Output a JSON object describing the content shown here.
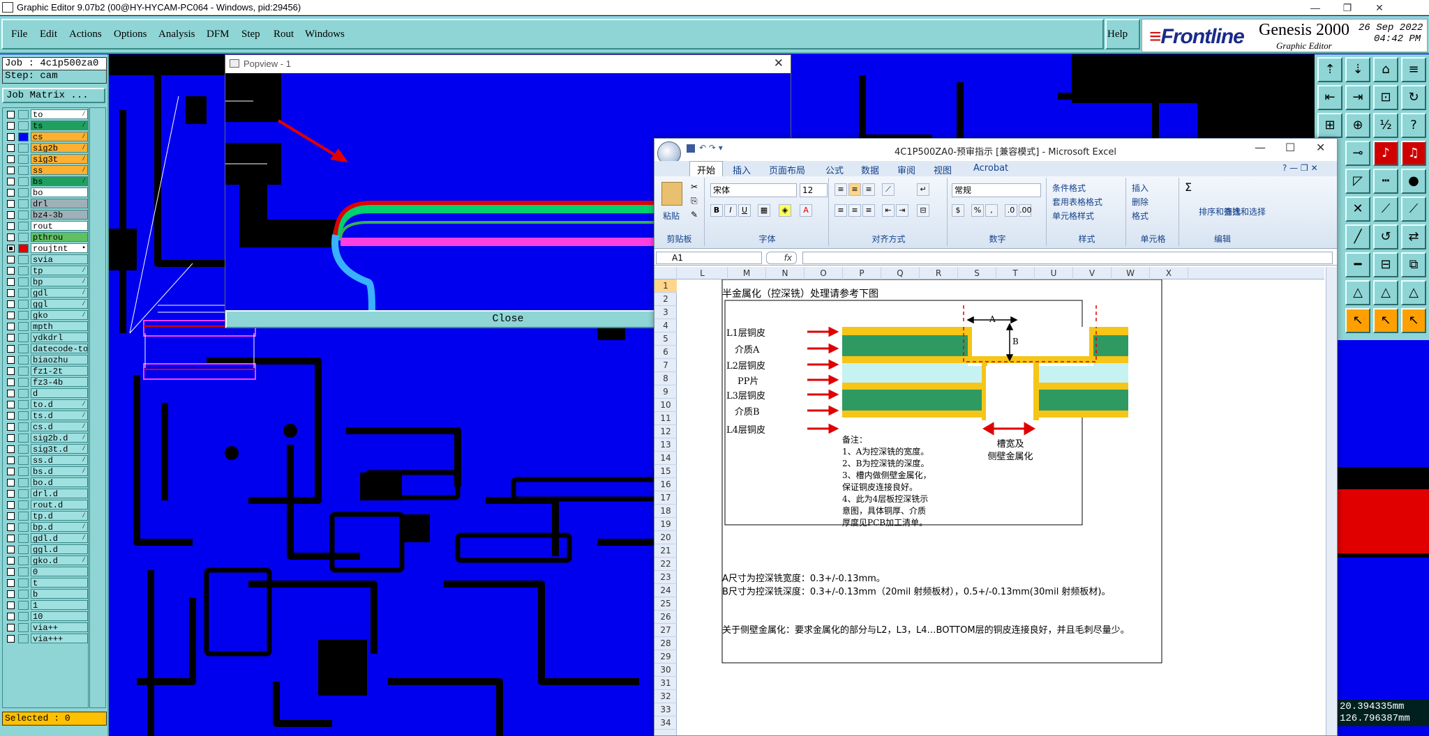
{
  "window": {
    "title": "Graphic Editor 9.07b2 (00@HY-HYCAM-PC064 - Windows, pid:29456)",
    "minimize": "—",
    "restore": "❐",
    "close": "✕"
  },
  "menubar": {
    "items": [
      "File",
      "Edit",
      "Actions",
      "Options",
      "Analysis",
      "DFM",
      "Step",
      "Rout",
      "Windows"
    ],
    "help": "Help"
  },
  "brand": {
    "logo": "Frontline",
    "product": "Genesis 2000",
    "subtitle": "Graphic Editor",
    "date": "26 Sep 2022",
    "time": "04:42 PM"
  },
  "leftpanel": {
    "job": "Job : 4c1p500za0",
    "step": "Step: cam",
    "job_matrix": "Job Matrix ...",
    "selected": "Selected : 0",
    "layers": [
      {
        "name": "to",
        "color": "white",
        "mark": "⁄"
      },
      {
        "name": "ts",
        "color": "green",
        "mark": "⁄"
      },
      {
        "name": "cs",
        "color": "orange",
        "mark": "⁄",
        "swatch": "#0000ff"
      },
      {
        "name": "sig2b",
        "color": "orange",
        "mark": "⁄"
      },
      {
        "name": "sig3t",
        "color": "orange",
        "mark": "⁄"
      },
      {
        "name": "ss",
        "color": "orange",
        "mark": "⁄"
      },
      {
        "name": "bs",
        "color": "green",
        "mark": "⁄"
      },
      {
        "name": "bo",
        "color": "white",
        "mark": ""
      },
      {
        "name": "drl",
        "color": "gray",
        "mark": ""
      },
      {
        "name": "bz4-3b",
        "color": "gray",
        "mark": ""
      },
      {
        "name": "rout",
        "color": "white",
        "mark": ""
      },
      {
        "name": "pthrou",
        "color": "greenl",
        "mark": ""
      },
      {
        "name": "roujtnt",
        "color": "white",
        "mark": "▪",
        "swatch": "#e00000",
        "checked": true
      },
      {
        "name": "svia",
        "color": "",
        "mark": ""
      },
      {
        "name": "tp",
        "color": "",
        "mark": "⁄"
      },
      {
        "name": "bp",
        "color": "",
        "mark": "⁄"
      },
      {
        "name": "gdl",
        "color": "",
        "mark": "⁄"
      },
      {
        "name": "ggl",
        "color": "",
        "mark": "⁄"
      },
      {
        "name": "gko",
        "color": "",
        "mark": "⁄"
      },
      {
        "name": "mpth",
        "color": "",
        "mark": ""
      },
      {
        "name": "ydkdrl",
        "color": "",
        "mark": ""
      },
      {
        "name": "datecode-to",
        "color": "",
        "mark": ""
      },
      {
        "name": "biaozhu",
        "color": "",
        "mark": ""
      },
      {
        "name": "fz1-2t",
        "color": "",
        "mark": ""
      },
      {
        "name": "fz3-4b",
        "color": "",
        "mark": ""
      },
      {
        "name": "d",
        "color": "",
        "mark": ""
      },
      {
        "name": "to.d",
        "color": "",
        "mark": "⁄"
      },
      {
        "name": "ts.d",
        "color": "",
        "mark": "⁄"
      },
      {
        "name": "cs.d",
        "color": "",
        "mark": "⁄"
      },
      {
        "name": "sig2b.d",
        "color": "",
        "mark": "⁄"
      },
      {
        "name": "sig3t.d",
        "color": "",
        "mark": "⁄"
      },
      {
        "name": "ss.d",
        "color": "",
        "mark": "⁄"
      },
      {
        "name": "bs.d",
        "color": "",
        "mark": "⁄"
      },
      {
        "name": "bo.d",
        "color": "",
        "mark": ""
      },
      {
        "name": "drl.d",
        "color": "",
        "mark": ""
      },
      {
        "name": "rout.d",
        "color": "",
        "mark": ""
      },
      {
        "name": "tp.d",
        "color": "",
        "mark": "⁄"
      },
      {
        "name": "bp.d",
        "color": "",
        "mark": "⁄"
      },
      {
        "name": "gdl.d",
        "color": "",
        "mark": "⁄"
      },
      {
        "name": "ggl.d",
        "color": "",
        "mark": ""
      },
      {
        "name": "gko.d",
        "color": "",
        "mark": "⁄"
      },
      {
        "name": "0",
        "color": "",
        "mark": ""
      },
      {
        "name": "t",
        "color": "",
        "mark": ""
      },
      {
        "name": "b",
        "color": "",
        "mark": ""
      },
      {
        "name": "1",
        "color": "",
        "mark": ""
      },
      {
        "name": "10",
        "color": "",
        "mark": ""
      },
      {
        "name": "via++",
        "color": "",
        "mark": ""
      },
      {
        "name": "via+++",
        "color": "",
        "mark": ""
      }
    ]
  },
  "popview": {
    "title": "Popview - 1",
    "close_x": "✕",
    "close_button": "Close"
  },
  "coords": {
    "x": "20.394335mm",
    "y": "126.796387mm"
  },
  "excel": {
    "title": "4C1P500ZA0-预审指示  [兼容模式] - Microsoft Excel",
    "tabs": [
      "开始",
      "插入",
      "页面布局",
      "公式",
      "数据",
      "审阅",
      "视图",
      "Acrobat"
    ],
    "ribbon": {
      "paste": "粘贴",
      "clipboard": "剪贴板",
      "font_name": "宋体",
      "font_size": "12",
      "font_group": "字体",
      "align_group": "对齐方式",
      "number_format": "常规",
      "number_group": "数字",
      "cond_format": "条件格式",
      "table_format": "套用表格格式",
      "cell_style": "单元格样式",
      "style_group": "样式",
      "insert": "插入",
      "delete": "删除",
      "format": "格式",
      "cells_group": "单元格",
      "sort_filter": "排序和筛选",
      "find_select": "查找和选择",
      "edit_group": "编辑"
    },
    "name_box": "A1",
    "fx": "fx",
    "columns": [
      "L",
      "M",
      "N",
      "O",
      "P",
      "Q",
      "R",
      "S",
      "T",
      "U",
      "V",
      "W",
      "X"
    ],
    "rows": [
      "1",
      "2",
      "3",
      "4",
      "5",
      "6",
      "7",
      "8",
      "9",
      "10",
      "11",
      "12",
      "13",
      "14",
      "15",
      "16",
      "17",
      "18",
      "19",
      "20",
      "21",
      "22",
      "23",
      "24",
      "25",
      "26",
      "27",
      "28",
      "29",
      "30",
      "31",
      "32",
      "33",
      "34"
    ],
    "sheet": {
      "heading": "半金属化（控深铣）处理请参考下图",
      "layer_labels": [
        "L1层铜皮",
        "介质A",
        "L2层铜皮",
        "PP片",
        "L3层铜皮",
        "介质B",
        "L4层铜皮"
      ],
      "dim_a": "A",
      "dim_b": "B",
      "notes": [
        "备注：",
        "1、A为控深铣的宽度。",
        "2、B为控深铣的深度。",
        "3、槽内做侧壁金属化，",
        "保证铜皮连接良好。",
        "4、此为4层板控深铣示",
        "意图，具体铜厚、介质",
        "厚度见PCB加工清单。"
      ],
      "slot_label_1": "槽宽及",
      "slot_label_2": "侧壁金属化",
      "line_a": "A尺寸为控深铣宽度：0.3+/-0.13mm。",
      "line_b": "B尺寸为控深铣深度：0.3+/-0.13mm（20mil 射频板材），0.5+/-0.13mm(30mil 射频板材)。",
      "line_c": "关于侧壁金属化：要求金属化的部分与L2，L3，L4…BOTTOM层的铜皮连接良好，并且毛刺尽量少。"
    }
  },
  "colors": {
    "canvas_bg": "#0000ee",
    "panel": "#8fd5d5",
    "copper": "#f5c518",
    "dielectric": "#2e9a62",
    "pp": "#c6f2f2"
  }
}
